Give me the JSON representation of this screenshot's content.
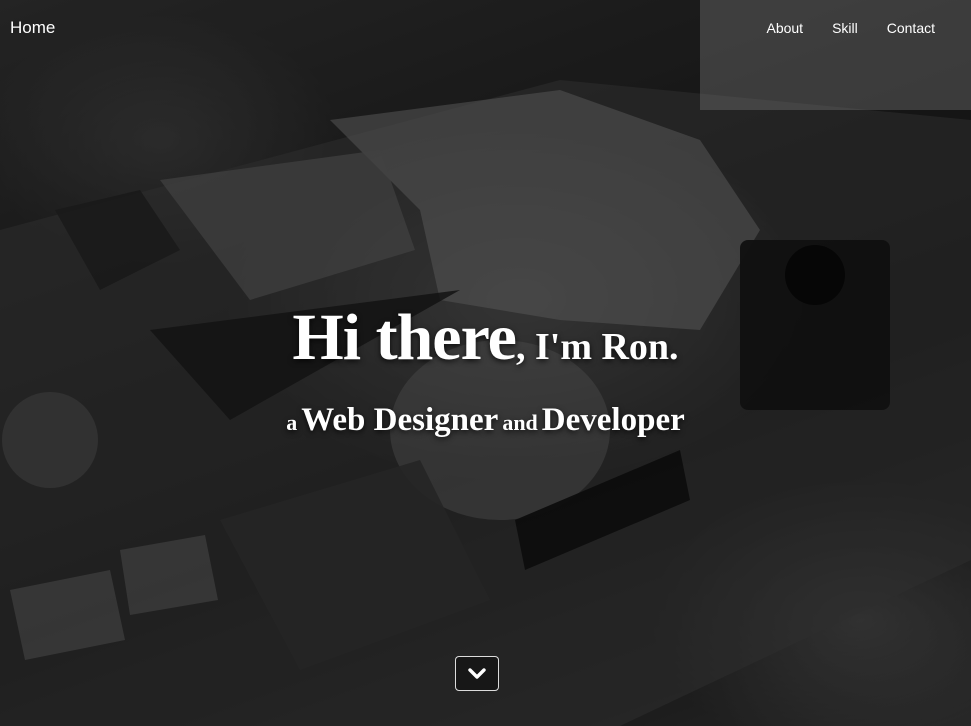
{
  "nav": {
    "home_label": "Home",
    "links": [
      {
        "label": "About"
      },
      {
        "label": "Skill"
      },
      {
        "label": "Contact"
      }
    ]
  },
  "hero": {
    "headline": {
      "part1": "Hi there",
      "part2": ", I'm Ron."
    },
    "subline": {
      "w1": "a",
      "w2": "Web Designer",
      "w3": "and",
      "w4": "Developer"
    },
    "scroll_icon": "chevron-down-icon"
  },
  "colors": {
    "text": "#ffffff",
    "overlay": "#000000"
  }
}
